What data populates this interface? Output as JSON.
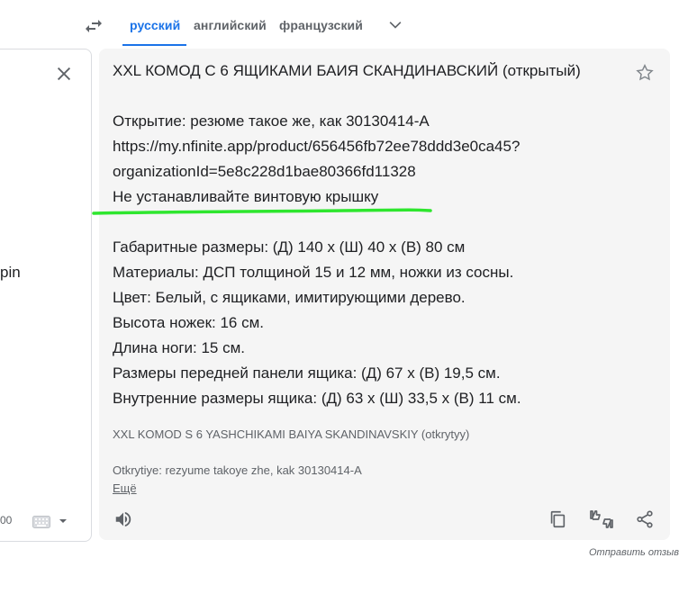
{
  "languages": {
    "tabs": [
      {
        "label": "русский"
      },
      {
        "label": "английский"
      },
      {
        "label": "французский"
      }
    ]
  },
  "source": {
    "visible_fragment": "pin",
    "char_count": "00"
  },
  "target": {
    "lines": [
      "XXL КОМОД С 6 ЯЩИКАМИ БАИЯ СКАНДИНАВСКИЙ (открытый)",
      "Открытие: резюме такое же, как 30130414-A",
      "https://my.nfinite.app/product/656456fb72ee78ddd3e0ca45?",
      "organizationId=5e8c228d1bae80366fd11328",
      "Не устанавливайте винтовую крышку",
      "Габаритные размеры: (Д) 140 x (Ш) 40 x (В) 80 см",
      "Материалы: ДСП толщиной 15 и 12 мм, ножки из сосны.",
      "Цвет: Белый, с ящиками, имитирующими дерево.",
      "Высота ножек: 16 см.",
      "Длина ноги: 15 см.",
      "Размеры передней панели ящика: (Д) 67 x (В) 19,5 см.",
      "Внутренние размеры ящика: (Д) 63 x (Ш) 33,5 x (В) 11 см."
    ],
    "transliteration_1": "XXL KOMOD S 6 YASHCHIKAMI BAIYA SKANDINAVSKIY (otkrytyy)",
    "transliteration_2": "Otkrytiye: rezyume takoye zhe, kak 30130414-A",
    "more_label": "Ещё",
    "highlight_color": "#2ee62e"
  },
  "feedback_label": "Отправить отзыв"
}
